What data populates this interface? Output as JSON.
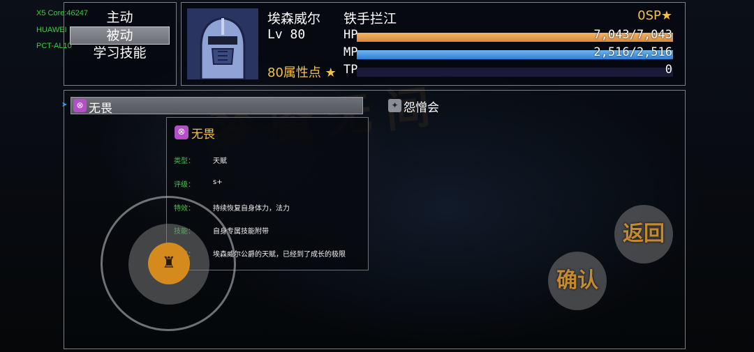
{
  "debug": {
    "line1": "X5 Core:46247",
    "line2": "HUAWEI",
    "line3": "PCT-AL10"
  },
  "menu": {
    "items": [
      {
        "label": "主动",
        "active": false
      },
      {
        "label": "被动",
        "active": true
      },
      {
        "label": "学习技能",
        "active": false
      }
    ]
  },
  "character": {
    "name": "埃森威尔",
    "level_text": "Lv 80",
    "class_name": "铁手拦江",
    "attr_points_text": "80属性点",
    "sp_text": "0SP",
    "stats": [
      {
        "label": "HP",
        "value": "7,043/7,043",
        "fraction": 1.0,
        "color_start": "#d9883a",
        "color_end": "#f3b567"
      },
      {
        "label": "MP",
        "value": "2,516/2,516",
        "fraction": 1.0,
        "color_start": "#2f7fd3",
        "color_end": "#6fb6f0"
      },
      {
        "label": "TP",
        "value": "0",
        "fraction": 0.0,
        "color_start": "#d9a23a",
        "color_end": "#f3d067"
      }
    ]
  },
  "skills": {
    "selected": "无畏",
    "other": "怨憎会"
  },
  "tooltip": {
    "title": "无畏",
    "rows": [
      {
        "key": "类型：",
        "value": "天赋"
      },
      {
        "key": "评级：",
        "value": "s+"
      },
      {
        "key": "特效：",
        "value": "持续恢复自身体力，法力"
      },
      {
        "key": "技能：",
        "value": "自身专属技能附带"
      },
      {
        "key": "描述：",
        "value": "埃森威尔公爵的天赋，已经到了成长的极限"
      }
    ]
  },
  "buttons": {
    "back": "返回",
    "confirm": "确认"
  },
  "watermark": "梦魇无间",
  "colors": {
    "accent_gold": "#f2c14a",
    "debug_green": "#35d23a",
    "label_green": "#38c94a"
  }
}
